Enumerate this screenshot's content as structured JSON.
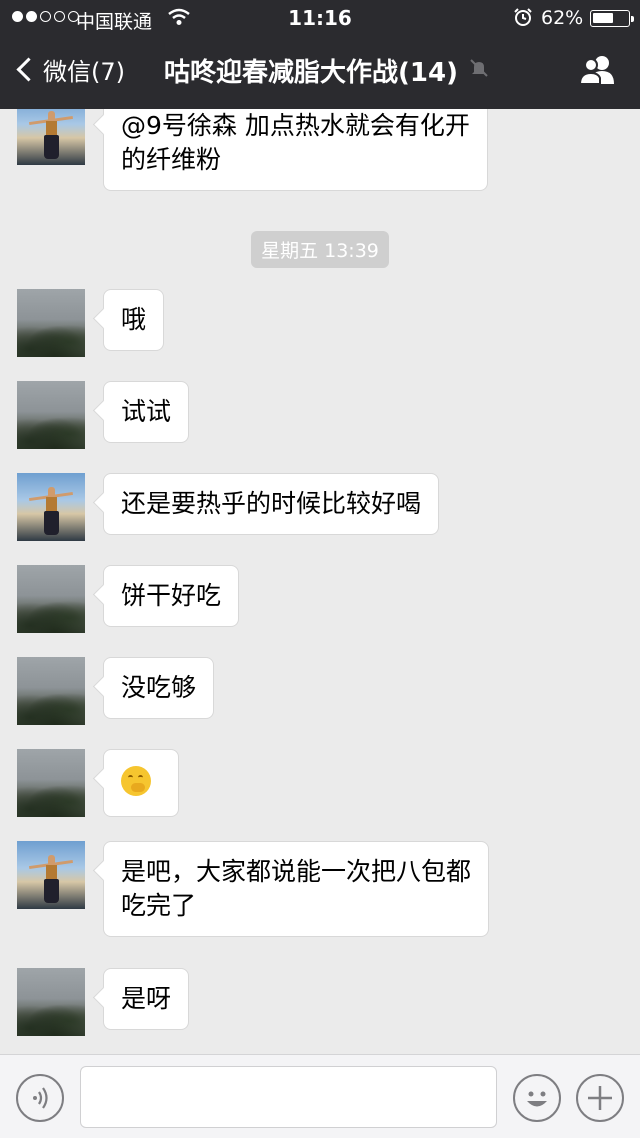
{
  "status_bar": {
    "carrier": "中国联通",
    "time": "11:16",
    "battery_percent_label": "62%",
    "battery_level": 0.62
  },
  "nav": {
    "back_label": "微信(7)",
    "title": "咕咚迎春减脂大作战(14)"
  },
  "chat": {
    "timestamp": "星期五 13:39",
    "messages": [
      {
        "avatar": "girl",
        "lines": [
          "@9号徐森 加点热水就会有化开",
          "的纤维粉"
        ]
      },
      {
        "avatar": "fog",
        "lines": [
          "哦"
        ]
      },
      {
        "avatar": "fog",
        "lines": [
          "试试"
        ]
      },
      {
        "avatar": "girl",
        "lines": [
          "还是要热乎的时候比较好喝"
        ]
      },
      {
        "avatar": "fog",
        "lines": [
          "饼干好吃"
        ]
      },
      {
        "avatar": "fog",
        "lines": [
          "没吃够"
        ]
      },
      {
        "avatar": "fog",
        "lines": [],
        "emoji": "thinking-face"
      },
      {
        "avatar": "girl",
        "lines": [
          "是吧，大家都说能一次把八包都",
          "吃完了"
        ]
      },
      {
        "avatar": "fog",
        "lines": [
          "是呀"
        ]
      }
    ]
  },
  "input": {
    "placeholder": ""
  },
  "colors": {
    "topbar": "#2b2b2f",
    "chat_bg": "#ebebeb",
    "bubble": "#ffffff"
  }
}
